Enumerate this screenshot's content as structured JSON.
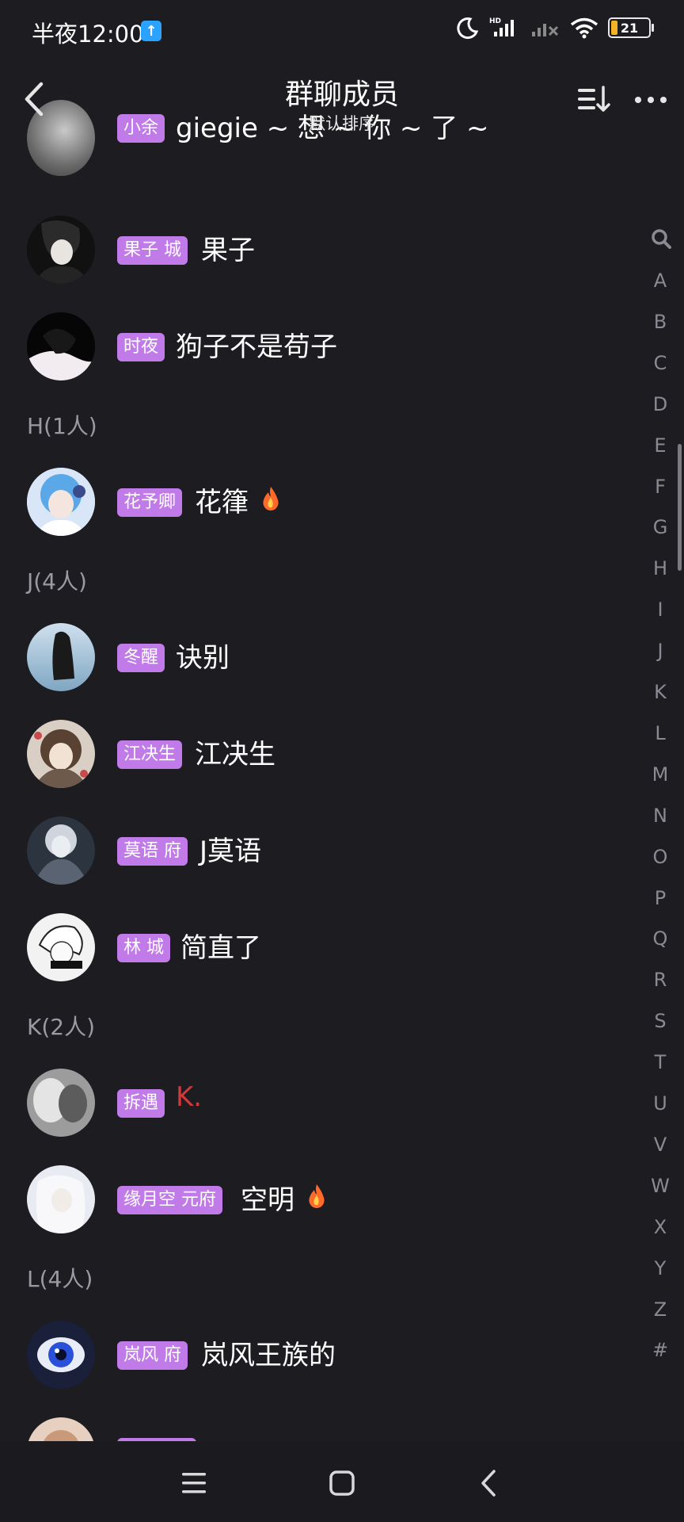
{
  "status_bar": {
    "time": "半夜12:00",
    "upload_icon": "arrow-up-icon",
    "battery": "21"
  },
  "header": {
    "title": "群聊成员",
    "subtitle": "默认排序"
  },
  "members": [
    {
      "badge": "小余",
      "name": "giegie ~ 想 ~ 你 ~ 了 ~",
      "flame": false
    },
    {
      "badge": "果子 城",
      "name": "果子",
      "flame": false
    },
    {
      "badge": "时夜",
      "name": "狗子不是苟子",
      "flame": false
    },
    {
      "badge": "花予卿",
      "name": "花箻",
      "flame": true
    },
    {
      "badge": "冬醒",
      "name": "诀别",
      "flame": false
    },
    {
      "badge": "江决生",
      "name": "江决生",
      "flame": false
    },
    {
      "badge": "莫语 府",
      "name": "J莫语",
      "flame": false
    },
    {
      "badge": "林 城",
      "name": "简直了",
      "flame": false
    },
    {
      "badge": "拆遇",
      "name": "K.",
      "flame": false,
      "name_color": "#d03a3a"
    },
    {
      "badge": "缘月空 元府",
      "name": "空明",
      "flame": true
    },
    {
      "badge": "岚风 府",
      "name": "岚风王族的",
      "flame": false
    }
  ],
  "sections": {
    "h": "H(1人)",
    "j": "J(4人)",
    "k": "K(2人)",
    "l": "L(4人)"
  },
  "index_letters": [
    "A",
    "B",
    "C",
    "D",
    "E",
    "F",
    "G",
    "H",
    "I",
    "J",
    "K",
    "L",
    "M",
    "N",
    "O",
    "P",
    "Q",
    "R",
    "S",
    "T",
    "U",
    "V",
    "W",
    "X",
    "Y",
    "Z",
    "#"
  ],
  "colors": {
    "background": "#1c1c21",
    "badge": "#c07be8",
    "section_text": "#9a9aa2"
  }
}
